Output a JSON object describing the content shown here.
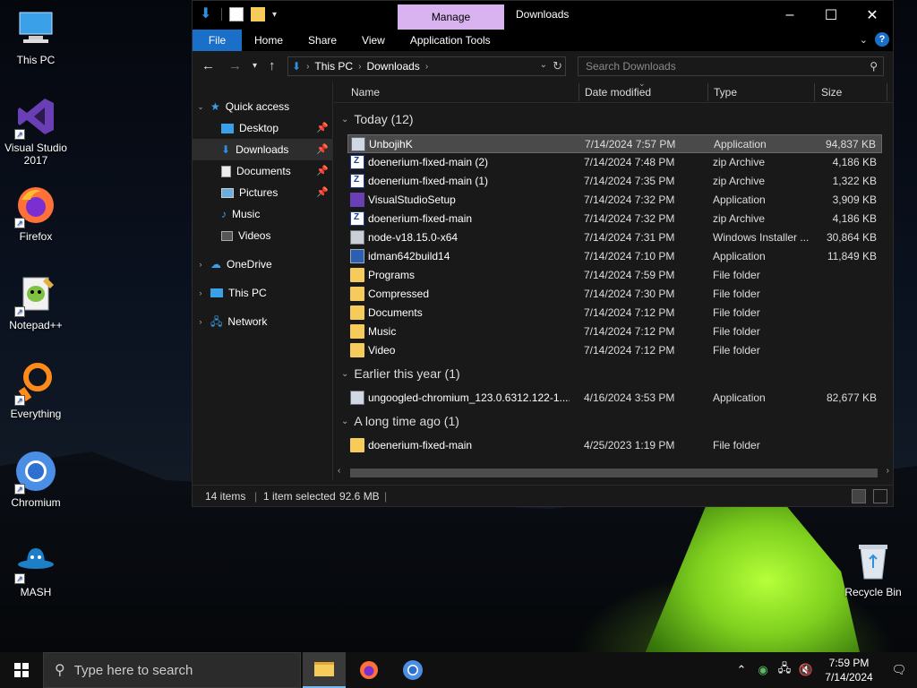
{
  "desktop": {
    "icons": [
      {
        "label": "This PC"
      },
      {
        "label": "Visual Studio 2017"
      },
      {
        "label": "Firefox"
      },
      {
        "label": "Notepad++"
      },
      {
        "label": "Everything"
      },
      {
        "label": "Chromium"
      },
      {
        "label": "MASH"
      },
      {
        "label": "Recycle Bin"
      }
    ]
  },
  "window": {
    "title": "Downloads",
    "contextual_tab": "Manage",
    "ribbon_tabs": [
      "File",
      "Home",
      "Share",
      "View",
      "Application Tools"
    ],
    "help": "?",
    "address": {
      "crumbs": [
        "This PC",
        "Downloads"
      ]
    },
    "search_placeholder": "Search Downloads",
    "nav": {
      "quick_access": "Quick access",
      "items": [
        {
          "label": "Desktop",
          "pinned": true
        },
        {
          "label": "Downloads",
          "pinned": true
        },
        {
          "label": "Documents",
          "pinned": true
        },
        {
          "label": "Pictures",
          "pinned": true
        },
        {
          "label": "Music",
          "pinned": false
        },
        {
          "label": "Videos",
          "pinned": false
        }
      ],
      "onedrive": "OneDrive",
      "this_pc": "This PC",
      "network": "Network"
    },
    "columns": {
      "name": "Name",
      "date": "Date modified",
      "type": "Type",
      "size": "Size"
    },
    "groups": [
      {
        "title": "Today (12)",
        "rows": [
          {
            "name": "UnbojihK",
            "date": "7/14/2024 7:57 PM",
            "type": "Application",
            "size": "94,837 KB",
            "icon": "app",
            "selected": true
          },
          {
            "name": "doenerium-fixed-main (2)",
            "date": "7/14/2024 7:48 PM",
            "type": "zip Archive",
            "size": "4,186 KB",
            "icon": "zip"
          },
          {
            "name": "doenerium-fixed-main (1)",
            "date": "7/14/2024 7:35 PM",
            "type": "zip Archive",
            "size": "1,322 KB",
            "icon": "zip"
          },
          {
            "name": "VisualStudioSetup",
            "date": "7/14/2024 7:32 PM",
            "type": "Application",
            "size": "3,909 KB",
            "icon": "vs"
          },
          {
            "name": "doenerium-fixed-main",
            "date": "7/14/2024 7:32 PM",
            "type": "zip Archive",
            "size": "4,186 KB",
            "icon": "zip"
          },
          {
            "name": "node-v18.15.0-x64",
            "date": "7/14/2024 7:31 PM",
            "type": "Windows Installer ...",
            "size": "30,864 KB",
            "icon": "msi"
          },
          {
            "name": "idman642build14",
            "date": "7/14/2024 7:10 PM",
            "type": "Application",
            "size": "11,849 KB",
            "icon": "app"
          },
          {
            "name": "Programs",
            "date": "7/14/2024 7:59 PM",
            "type": "File folder",
            "size": "",
            "icon": "folder"
          },
          {
            "name": "Compressed",
            "date": "7/14/2024 7:30 PM",
            "type": "File folder",
            "size": "",
            "icon": "folder"
          },
          {
            "name": "Documents",
            "date": "7/14/2024 7:12 PM",
            "type": "File folder",
            "size": "",
            "icon": "folder"
          },
          {
            "name": "Music",
            "date": "7/14/2024 7:12 PM",
            "type": "File folder",
            "size": "",
            "icon": "folder"
          },
          {
            "name": "Video",
            "date": "7/14/2024 7:12 PM",
            "type": "File folder",
            "size": "",
            "icon": "folder"
          }
        ]
      },
      {
        "title": "Earlier this year (1)",
        "rows": [
          {
            "name": "ungoogled-chromium_123.0.6312.122-1....",
            "date": "4/16/2024 3:53 PM",
            "type": "Application",
            "size": "82,677 KB",
            "icon": "app"
          }
        ]
      },
      {
        "title": "A long time ago (1)",
        "rows": [
          {
            "name": "doenerium-fixed-main",
            "date": "4/25/2023 1:19 PM",
            "type": "File folder",
            "size": "",
            "icon": "folder"
          }
        ]
      }
    ],
    "status": {
      "items": "14 items",
      "selected": "1 item selected",
      "size": "92.6 MB"
    }
  },
  "taskbar": {
    "search_placeholder": "Type here to search",
    "time": "7:59 PM",
    "date": "7/14/2024"
  },
  "colors": {
    "accent": "#1a6fc9",
    "manage_tab": "#d9b3f0",
    "folder": "#f5cb5c"
  }
}
